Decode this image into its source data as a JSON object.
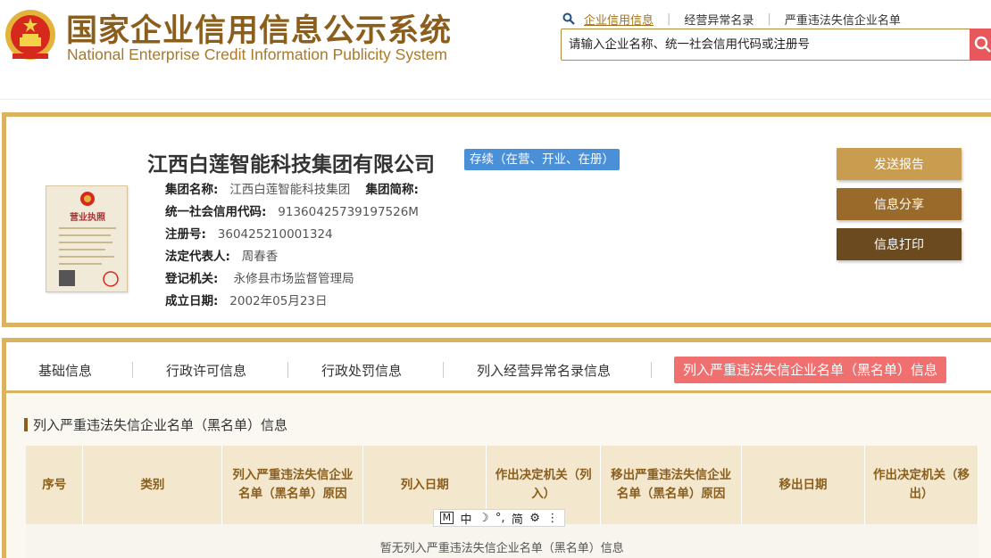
{
  "site": {
    "title_cn": "国家企业信用信息公示系统",
    "title_en": "National Enterprise Credit Information Publicity System"
  },
  "topnav": {
    "items": [
      "企业信用信息",
      "经营异常名录",
      "严重违法失信企业名单"
    ],
    "active_index": 0
  },
  "search": {
    "placeholder": "请输入企业名称、统一社会信用代码或注册号",
    "value": ""
  },
  "company": {
    "name": "江西白莲智能科技集团有限公司",
    "status": "存续（在营、开业、在册）",
    "group_name_label": "集团名称:",
    "group_name_value": "江西白莲智能科技集团",
    "group_short_label": "集团简称:",
    "group_short_value": "",
    "credit_code_label": "统一社会信用代码:",
    "credit_code_value": "91360425739197526M",
    "reg_no_label": "注册号:",
    "reg_no_value": "360425210001324",
    "legal_rep_label": "法定代表人:",
    "legal_rep_value": "周春香",
    "authority_label": "登记机关:",
    "authority_value": "永修县市场监督管理局",
    "founded_label": "成立日期:",
    "founded_value": "2002年05月23日",
    "license_image_text": "营业执照"
  },
  "actions": {
    "send_report": "发送报告",
    "share": "信息分享",
    "print": "信息打印"
  },
  "tabs": [
    {
      "label": "基础信息"
    },
    {
      "label": "行政许可信息"
    },
    {
      "label": "行政处罚信息"
    },
    {
      "label": "列入经营异常名录信息"
    },
    {
      "label": "列入严重违法失信企业名单（黑名单）信息"
    }
  ],
  "active_tab_index": 4,
  "section": {
    "title": "列入严重违法失信企业名单（黑名单）信息"
  },
  "table": {
    "headers": [
      "序号",
      "类别",
      "列入严重违法失信企业名单（黑名单）原因",
      "列入日期",
      "作出决定机关（列入）",
      "移出严重违法失信企业名单（黑名单）原因",
      "移出日期",
      "作出决定机关（移出）"
    ],
    "empty_message": "暂无列入严重违法失信企业名单（黑名单）信息"
  },
  "ime": {
    "items": [
      "M",
      "中",
      "☽",
      "°,",
      "简",
      "⚙",
      "⋮"
    ]
  },
  "colors": {
    "gold_border": "#d9b35f",
    "brand_brown": "#8b5e1c",
    "active_tab": "#f06f6f",
    "status_badge": "#4a90d9",
    "search_button": "#e8575b"
  }
}
